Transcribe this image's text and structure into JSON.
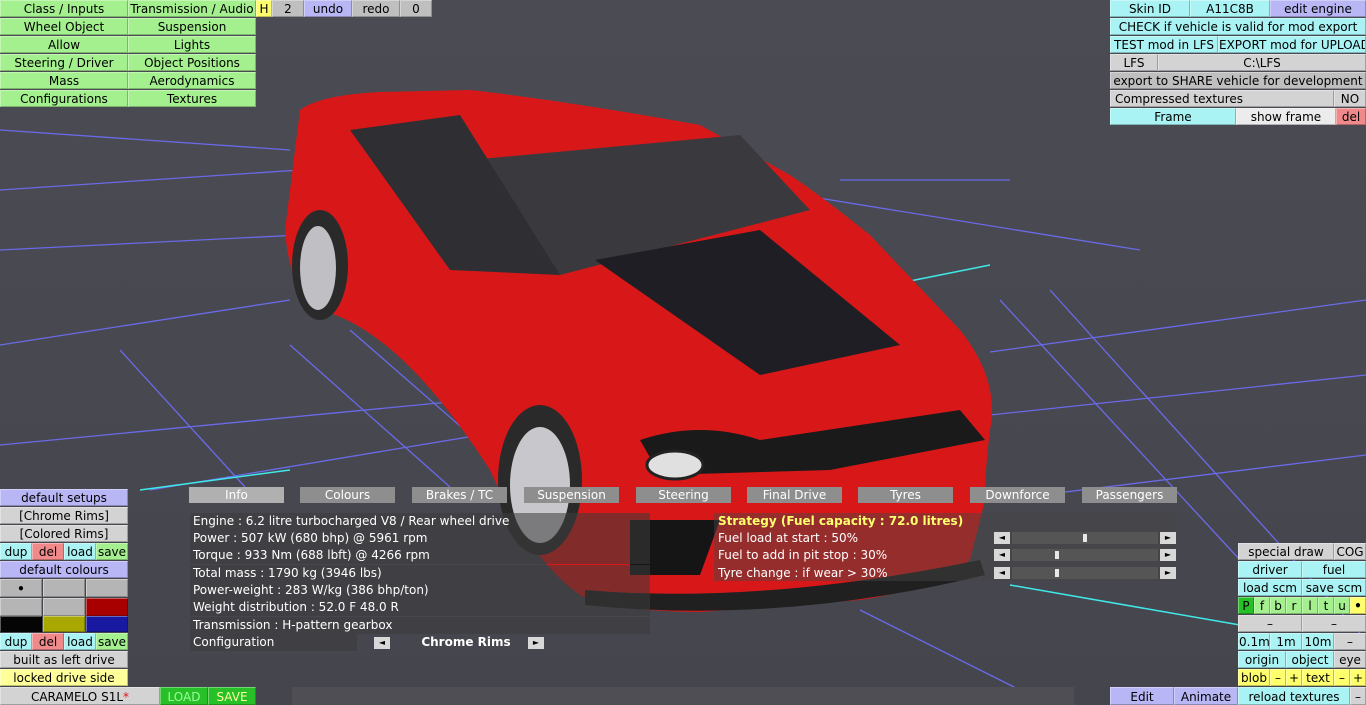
{
  "top_left_menu": {
    "col1": [
      "Class / Inputs",
      "Wheel Object",
      "Allow",
      "Steering / Driver",
      "Mass",
      "Configurations"
    ],
    "col2": [
      "Transmission / Audio",
      "Suspension",
      "Lights",
      "Object Positions",
      "Aerodynamics",
      "Textures"
    ],
    "h_label": "H",
    "h_value": "2",
    "undo": "undo",
    "redo": "redo",
    "redo_count": "0"
  },
  "top_right": {
    "skin_id_label": "Skin ID",
    "skin_id_value": "A11C8B",
    "edit_engine": "edit engine",
    "check_valid": "CHECK if vehicle is valid for mod export",
    "test_mod": "TEST mod in LFS",
    "export_mod": "EXPORT mod for UPLOAD",
    "lfs_label": "LFS",
    "lfs_path": "C:\\LFS",
    "export_share": "export to SHARE vehicle for development",
    "compressed_label": "Compressed textures",
    "compressed_value": "NO",
    "frame": "Frame",
    "show_frame": "show frame",
    "del": "del"
  },
  "tabs": [
    "Info",
    "Colours",
    "Brakes / TC",
    "Suspension",
    "Steering",
    "Final Drive",
    "Tyres",
    "Downforce",
    "Passengers"
  ],
  "info_lines": [
    "Engine : 6.2 litre turbocharged V8 / Rear wheel drive",
    "Power : 507 kW (680 bhp) @ 5961 rpm",
    "Torque : 933 Nm (688 lbft) @ 4266 rpm",
    "Total mass : 1790 kg (3946 lbs)",
    "Power-weight : 283 W/kg (386 bhp/ton)",
    "Weight distribution : 52.0 F  48.0 R",
    "Transmission : H-pattern gearbox"
  ],
  "configuration": {
    "label": "Configuration",
    "value": "Chrome Rims",
    "left_arrow": "◄",
    "right_arrow": "►"
  },
  "strategy": {
    "title": "Strategy (Fuel capacity : 72.0 litres)",
    "rows": [
      {
        "label": "Fuel load at start : 50%",
        "level": 0.5
      },
      {
        "label": "Fuel to add in pit stop : 30%",
        "level": 0.3
      },
      {
        "label": "Tyre change : if wear > 30%",
        "level": 0.3
      }
    ],
    "left_arrow": "◄",
    "right_arrow": "►"
  },
  "bottom_left": {
    "default_setups": "default setups",
    "chrome_rims": "[Chrome Rims]",
    "colored_rims": "[Colored Rims]",
    "dup": "dup",
    "del": "del",
    "load": "load",
    "save": "save",
    "default_colours": "default colours",
    "selected_marker": "•",
    "swatch_colors": [
      "#b5b5b5",
      "#b5b5b5",
      "#b5b5b5",
      "#b5b5b5",
      "#b5b5b5",
      "#a80000",
      "#050505",
      "#a8a800",
      "#1818a0"
    ],
    "built_as_left_drive": "built as left drive",
    "locked_drive_side": "locked drive side",
    "vehicle_name": "CARAMELO S1L",
    "modified_marker": "*",
    "load_btn": "LOAD",
    "save_btn": "SAVE"
  },
  "bottom_right": {
    "special_draw": "special draw",
    "cog": "COG",
    "driver": "driver",
    "fuel": "fuel",
    "load_scm": "load scm",
    "save_scm": "save scm",
    "letters": [
      "P",
      "f",
      "b",
      "r",
      "l",
      "t",
      "u"
    ],
    "dot": "•",
    "minus": "–",
    "dist_01": "0.1m",
    "dist_1": "1m",
    "dist_10": "10m",
    "origin": "origin",
    "object": "object",
    "eye": "eye",
    "blob": "blob",
    "plus": "+",
    "text": "text",
    "edit": "Edit",
    "animate": "Animate",
    "reload_textures": "reload textures"
  },
  "colors": {
    "green": "#a4f08e",
    "cyan": "#a9f3f4",
    "violet": "#b8b6f4",
    "pink": "#f08a8a",
    "yellow": "#ffff6e",
    "car_red": "#e01818",
    "grid_blue": "#6a6ae8",
    "grid_cyan": "#40e8e8"
  }
}
